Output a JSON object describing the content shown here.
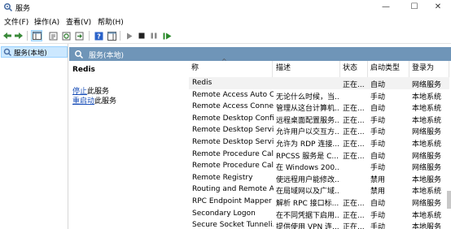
{
  "window": {
    "title": "服务",
    "minimize": "—",
    "maximize": "☐",
    "close": "✕"
  },
  "menu": [
    "文件(F)",
    "操作(A)",
    "查看(V)",
    "帮助(H)"
  ],
  "tree": {
    "item": "服务(本地)"
  },
  "pane": {
    "header": "服务(本地)",
    "selected_service": "Redis",
    "actions": [
      {
        "link": "停止",
        "rest": "此服务"
      },
      {
        "link": "重启动",
        "rest": "此服务"
      }
    ]
  },
  "columns": [
    "称",
    "描述",
    "状态",
    "启动类型",
    "登录为"
  ],
  "rows": [
    {
      "name": "Redis",
      "desc": "",
      "status": "正在...",
      "startup": "自动",
      "logon": "网络服务",
      "selected": true
    },
    {
      "name": "Remote Access Auto C...",
      "desc": "无论什么时候，当...",
      "status": "",
      "startup": "手动",
      "logon": "本地系统"
    },
    {
      "name": "Remote Access Conne...",
      "desc": "管理从这台计算机...",
      "status": "正在...",
      "startup": "自动",
      "logon": "本地系统"
    },
    {
      "name": "Remote Desktop Confi...",
      "desc": "远程桌面配置服务...",
      "status": "正在...",
      "startup": "手动",
      "logon": "本地系统"
    },
    {
      "name": "Remote Desktop Servi...",
      "desc": "允许用户以交互方...",
      "status": "正在...",
      "startup": "手动",
      "logon": "网络服务"
    },
    {
      "name": "Remote Desktop Servi...",
      "desc": "允许为 RDP 连接...",
      "status": "正在...",
      "startup": "手动",
      "logon": "本地系统"
    },
    {
      "name": "Remote Procedure Cal...",
      "desc": "RPCSS 服务是 C...",
      "status": "正在...",
      "startup": "自动",
      "logon": "网络服务"
    },
    {
      "name": "Remote Procedure Cal...",
      "desc": "在 Windows 200...",
      "status": "",
      "startup": "手动",
      "logon": "网络服务"
    },
    {
      "name": "Remote Registry",
      "desc": "使远程用户能修改...",
      "status": "",
      "startup": "禁用",
      "logon": "本地服务"
    },
    {
      "name": "Routing and Remote A...",
      "desc": "在局域网以及广域...",
      "status": "",
      "startup": "禁用",
      "logon": "本地系统"
    },
    {
      "name": "RPC Endpoint Mapper",
      "desc": "解析 RPC 接口标...",
      "status": "正在...",
      "startup": "自动",
      "logon": "网络服务"
    },
    {
      "name": "Secondary Logon",
      "desc": "在不同凭据下启用...",
      "status": "正在...",
      "startup": "手动",
      "logon": "本地系统"
    },
    {
      "name": "Secure Socket Tunneli...",
      "desc": "提供使用 VPN 连...",
      "status": "正在...",
      "startup": "手动",
      "logon": "本地服务"
    }
  ]
}
